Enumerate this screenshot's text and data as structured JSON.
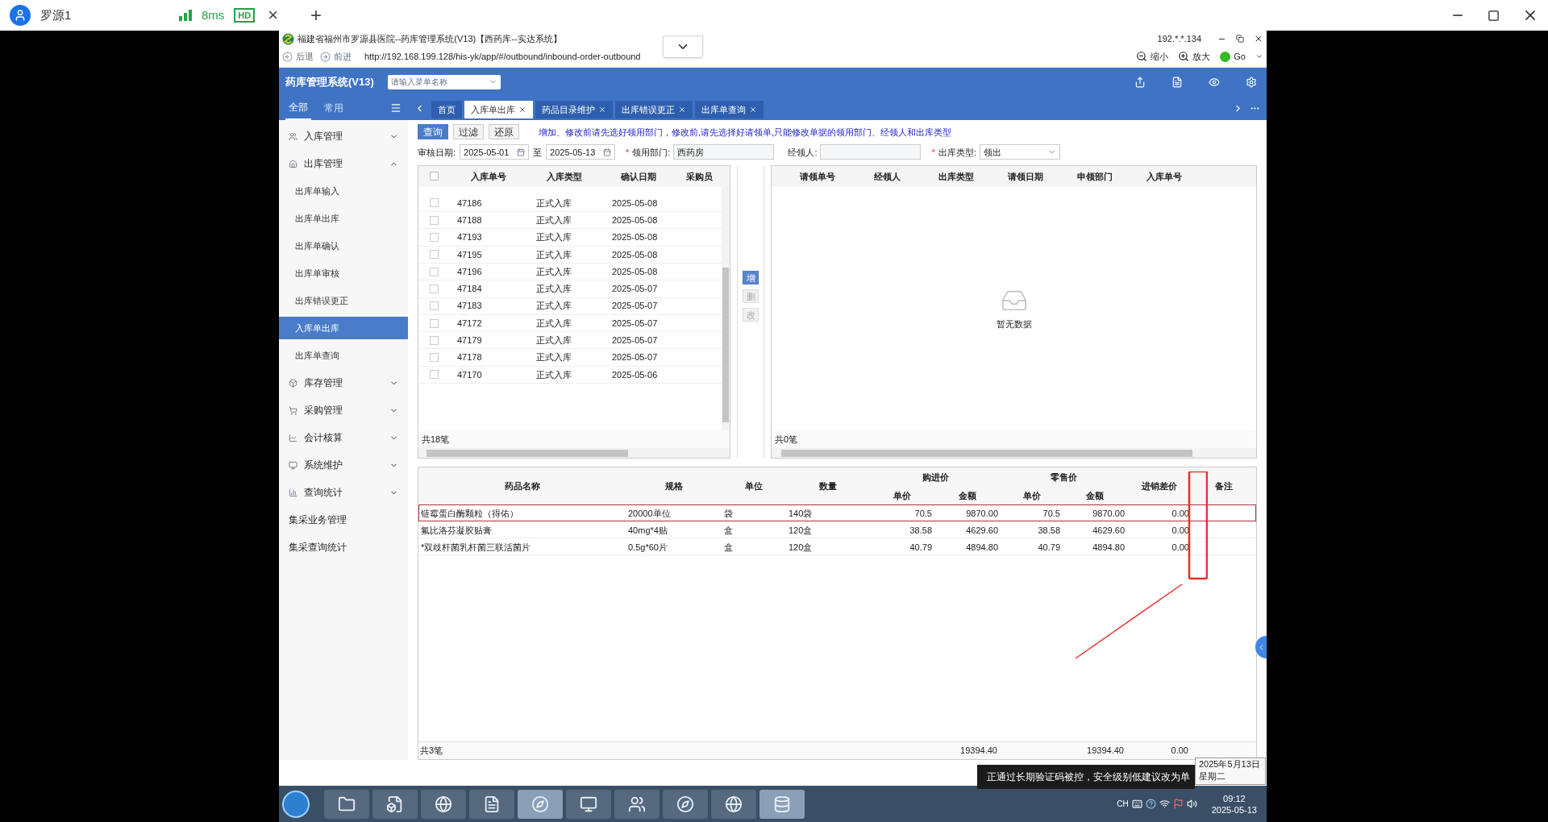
{
  "client": {
    "title": "罗源1",
    "latency": "8ms",
    "quality": "HD",
    "close_tab": "×",
    "new_tab": "+"
  },
  "browser": {
    "title": "福建省福州市罗源县医院--药库管理系统(V13)【西药库--实达系统】",
    "ip": "192.*.*.134",
    "back": "后退",
    "forward": "前进",
    "url": "http://192.168.199.128/his-yk/app/#/outbound/inbound-order-outbound",
    "zoom_out": "缩小",
    "zoom_in": "放大",
    "go": "Go"
  },
  "app": {
    "title": "药库管理系统(V13)",
    "search_placeholder": "请输入菜单名称"
  },
  "sidebar": {
    "tabs": [
      {
        "label": "全部",
        "selected": true
      },
      {
        "label": "常用",
        "selected": false
      }
    ],
    "items": [
      {
        "label": "入库管理",
        "kind": "menu",
        "expanded": false
      },
      {
        "label": "出库管理",
        "kind": "menu",
        "expanded": true,
        "children": [
          {
            "label": "出库单输入",
            "selected": false
          },
          {
            "label": "出库单出库",
            "selected": false
          },
          {
            "label": "出库单确认",
            "selected": false
          },
          {
            "label": "出库单审核",
            "selected": false
          },
          {
            "label": "出库错误更正",
            "selected": false
          },
          {
            "label": "入库单出库",
            "selected": true
          },
          {
            "label": "出库单查询",
            "selected": false
          }
        ]
      },
      {
        "label": "库存管理",
        "kind": "menu",
        "expanded": false
      },
      {
        "label": "采购管理",
        "kind": "menu",
        "expanded": false
      },
      {
        "label": "会计核算",
        "kind": "menu",
        "expanded": false
      },
      {
        "label": "系统维护",
        "kind": "menu",
        "expanded": false
      },
      {
        "label": "查询统计",
        "kind": "menu",
        "expanded": false
      },
      {
        "label": "集采业务管理",
        "kind": "link"
      },
      {
        "label": "集采查询统计",
        "kind": "link"
      }
    ]
  },
  "tabs": [
    {
      "label": "首页",
      "closable": false,
      "selected": false
    },
    {
      "label": "入库单出库",
      "closable": true,
      "selected": true
    },
    {
      "label": "药品目录维护",
      "closable": true,
      "selected": false
    },
    {
      "label": "出库错误更正",
      "closable": true,
      "selected": false
    },
    {
      "label": "出库单查询",
      "closable": true,
      "selected": false
    }
  ],
  "toolbar": {
    "buttons": [
      {
        "label": "查询",
        "selected": true
      },
      {
        "label": "过滤",
        "selected": false
      },
      {
        "label": "还原",
        "selected": false
      }
    ],
    "notice": "增加、修改前请先选好领用部门，修改前,请先选择好请领单,只能修改单据的领用部门、经领人和出库类型"
  },
  "filters": {
    "required_marker": "*",
    "date_label": "审核日期:",
    "date_from": "2025-05-01",
    "date_sep": "至",
    "date_to": "2025-05-13",
    "fields": [
      {
        "label": "领用部门:",
        "required": true,
        "value": "西药房",
        "kind": "text"
      },
      {
        "label": "经领人:",
        "required": false,
        "kind": "text"
      },
      {
        "label": "出库类型:",
        "required": true,
        "value": "领出",
        "kind": "select"
      }
    ]
  },
  "inbound_table": {
    "columns": [
      "入库单号",
      "入库类型",
      "确认日期",
      "采购员"
    ],
    "header_checked": false,
    "rows": [
      {
        "no": "47186",
        "type": "正式入库",
        "date": "2025-05-08",
        "checked": false
      },
      {
        "no": "47188",
        "type": "正式入库",
        "date": "2025-05-08",
        "checked": false
      },
      {
        "no": "47193",
        "type": "正式入库",
        "date": "2025-05-08",
        "checked": false
      },
      {
        "no": "47195",
        "type": "正式入库",
        "date": "2025-05-08",
        "checked": false
      },
      {
        "no": "47196",
        "type": "正式入库",
        "date": "2025-05-08",
        "checked": false
      },
      {
        "no": "47184",
        "type": "正式入库",
        "date": "2025-05-07",
        "checked": false
      },
      {
        "no": "47183",
        "type": "正式入库",
        "date": "2025-05-07",
        "checked": false
      },
      {
        "no": "47172",
        "type": "正式入库",
        "date": "2025-05-07",
        "checked": false
      },
      {
        "no": "47179",
        "type": "正式入库",
        "date": "2025-05-07",
        "checked": false
      },
      {
        "no": "47178",
        "type": "正式入库",
        "date": "2025-05-07",
        "checked": false
      },
      {
        "no": "47170",
        "type": "正式入库",
        "date": "2025-05-06",
        "checked": false
      }
    ],
    "footer": "共18笔"
  },
  "side_buttons": [
    {
      "label": "增",
      "disabled": false
    },
    {
      "label": "删",
      "disabled": true
    },
    {
      "label": "改",
      "disabled": true
    }
  ],
  "request_table": {
    "columns": [
      "请领单号",
      "经领人",
      "出库类型",
      "请领日期",
      "申领部门",
      "入库单号"
    ],
    "empty_text": "暂无数据",
    "footer": "共0笔"
  },
  "detail_table": {
    "column_groups": [
      {
        "label": "购进价"
      },
      {
        "label": "零售价"
      }
    ],
    "columns": [
      "药品名称",
      "规格",
      "单位",
      "数量",
      "单价",
      "金额",
      "单价",
      "金额",
      "进销差价",
      "备注"
    ],
    "rows": [
      {
        "cells": [
          "链霉蛋白酶颗粒（得佑）",
          "20000单位",
          "袋",
          "140袋",
          "70.5",
          "9870.00",
          "70.5",
          "9870.00",
          "0.00"
        ],
        "selected": true
      },
      {
        "cells": [
          "氟比洛芬凝胶贴膏",
          "40mg*4贴",
          "盒",
          "120盒",
          "38.58",
          "4629.60",
          "38.58",
          "4629.60",
          "0.00"
        ],
        "selected": false
      },
      {
        "cells": [
          "*双歧杆菌乳杆菌三联活菌片",
          "0.5g*60片",
          "盒",
          "120盒",
          "40.79",
          "4894.80",
          "40.79",
          "4894.80",
          "0.00"
        ],
        "selected": false
      }
    ],
    "footer": {
      "label": "共3笔",
      "buy_amount": "19394.40",
      "retail_amount": "19394.40",
      "diff": "0.00"
    }
  },
  "notification": "正通过长期验证码被控，安全级别低建议改为单",
  "date_tooltip": {
    "date": "2025年5月13日",
    "weekday": "星期二"
  },
  "taskbar": {
    "language": "CH",
    "time": "09:12",
    "date": "2025-05-13"
  }
}
